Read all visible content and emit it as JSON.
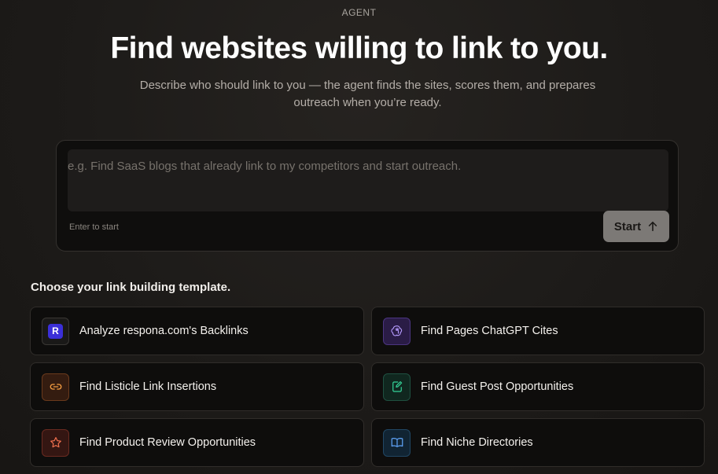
{
  "header": {
    "eyebrow": "AGENT",
    "title": "Find websites willing to link to you.",
    "subtitle": "Describe who should link to you — the agent finds the sites, scores them, and prepares outreach when you’re ready."
  },
  "prompt": {
    "placeholder": "e.g. Find SaaS blogs that already link to my competitors and start outreach.",
    "value": "",
    "hint": "Enter to start",
    "start_label": "Start"
  },
  "templates": {
    "title": "Choose your link building template.",
    "items": [
      {
        "label": "Analyze respona.com's Backlinks",
        "icon": "respona-logo-icon",
        "logo_letter": "R",
        "color": "#3b2fd8"
      },
      {
        "label": "Find Pages ChatGPT Cites",
        "icon": "openai-icon",
        "color": "#a78bfa"
      },
      {
        "label": "Find Listicle Link Insertions",
        "icon": "link-icon",
        "color": "#f59e42"
      },
      {
        "label": "Find Guest Post Opportunities",
        "icon": "edit-document-icon",
        "color": "#34d399"
      },
      {
        "label": "Find Product Review Opportunities",
        "icon": "star-icon",
        "color": "#f2714f"
      },
      {
        "label": "Find Niche Directories",
        "icon": "book-open-icon",
        "color": "#60a5fa"
      }
    ]
  }
}
